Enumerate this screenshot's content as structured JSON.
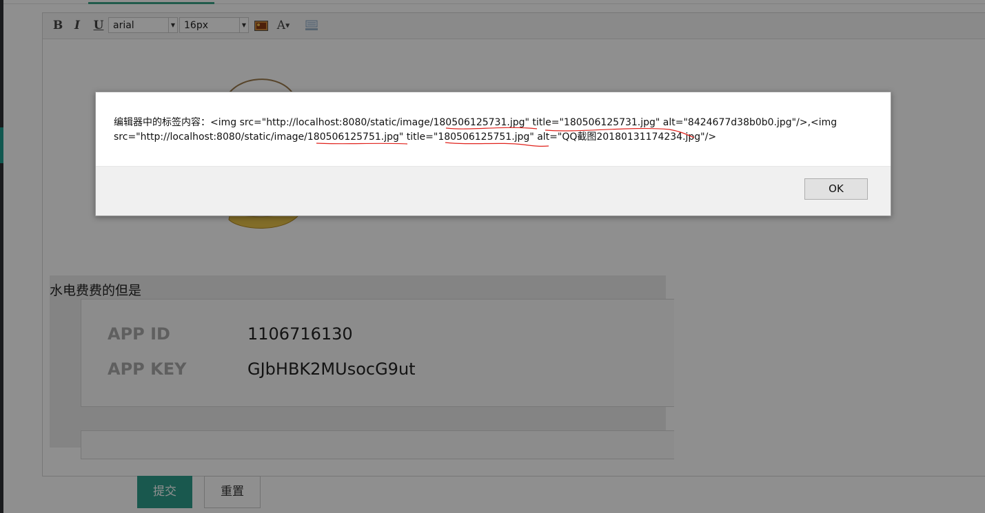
{
  "toolbar": {
    "bold": "B",
    "italic": "I",
    "underline": "U",
    "font_family": "arial",
    "font_size": "16px",
    "font_color": "A"
  },
  "content": {
    "paragraph": "水电费费的但是",
    "app_id_label": "APP ID",
    "app_id_value": "1106716130",
    "app_key_label": "APP KEY",
    "app_key_value": "GJbHBK2MUsocG9ut"
  },
  "actions": {
    "submit": "提交",
    "reset": "重置"
  },
  "dialog": {
    "line1": "编辑器中的标签内容：<img src=\"http://localhost:8080/static/image/180506125731.jpg\" title=\"180506125731.jpg\" alt=\"8424677d38b0b0.jpg\"/>,<img",
    "line2": "src=\"http://localhost:8080/static/image/180506125751.jpg\" title=\"180506125751.jpg\" alt=\"QQ截图20180131174234.jpg\"/>",
    "ok": "OK"
  },
  "colors": {
    "accent": "#2e9e8c",
    "annotation": "#e0201a"
  }
}
